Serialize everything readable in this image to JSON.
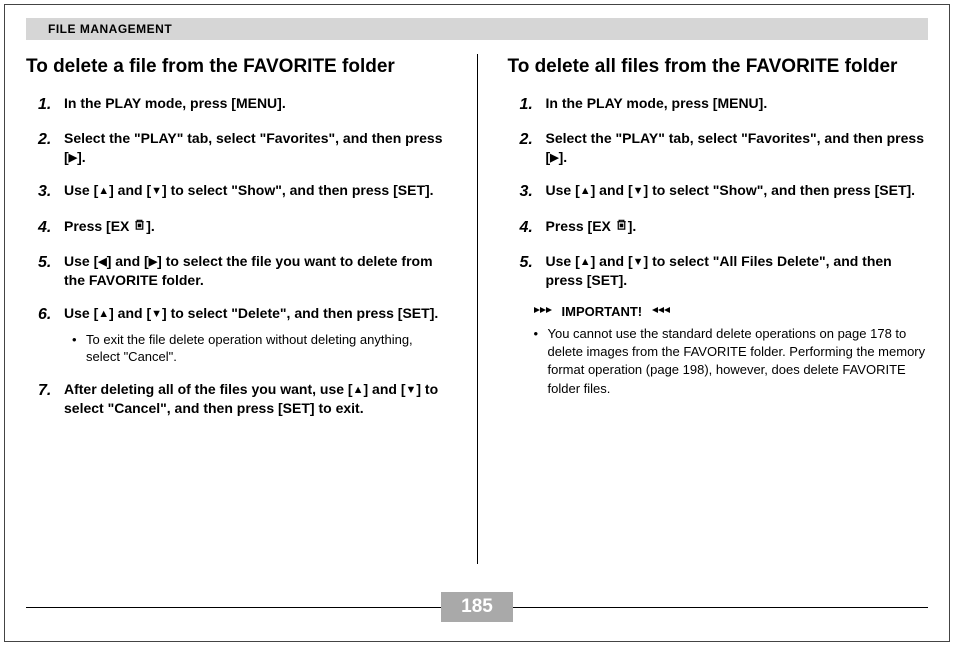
{
  "section_title": "FILE MANAGEMENT",
  "page_number": "185",
  "glyphs": {
    "triangle_up": "▲",
    "triangle_down": "▼",
    "triangle_left": "◀",
    "triangle_right": "▶"
  },
  "left": {
    "heading": "To delete a file from the FAVORITE folder",
    "steps": [
      {
        "num": "1.",
        "text": "In the PLAY mode, press [MENU]."
      },
      {
        "num": "2.",
        "text_before": "Select the \"PLAY\" tab, select \"Favorites\", and then press [",
        "arrow": "right",
        "text_after": "]."
      },
      {
        "num": "3.",
        "text_before": "Use [",
        "arrow1": "up",
        "mid": "] and [",
        "arrow2": "down",
        "text_after": "] to select \"Show\", and then press [SET]."
      },
      {
        "num": "4.",
        "text_before": "Press [EX ",
        "trash": true,
        "text_after": "]."
      },
      {
        "num": "5.",
        "text_before": "Use [",
        "arrow1": "left",
        "mid": "] and [",
        "arrow2": "right",
        "text_after": "] to select the file you want to delete from the FAVORITE folder."
      },
      {
        "num": "6.",
        "text_before": "Use [",
        "arrow1": "up",
        "mid": "] and [",
        "arrow2": "down",
        "text_after": "] to select \"Delete\", and then press [SET].",
        "sub": "To exit the file delete operation without deleting anything, select \"Cancel\"."
      },
      {
        "num": "7.",
        "text_before": "After deleting all of the files you want, use [",
        "arrow1": "up",
        "mid": "] and [",
        "arrow2": "down",
        "text_after": "] to select \"Cancel\", and then press [SET] to exit."
      }
    ]
  },
  "right": {
    "heading": "To delete all files from the FAVORITE folder",
    "steps": [
      {
        "num": "1.",
        "text": "In the PLAY mode, press [MENU]."
      },
      {
        "num": "2.",
        "text_before": "Select the \"PLAY\" tab, select \"Favorites\", and then press [",
        "arrow": "right",
        "text_after": "]."
      },
      {
        "num": "3.",
        "text_before": "Use [",
        "arrow1": "up",
        "mid": "] and [",
        "arrow2": "down",
        "text_after": "] to select \"Show\", and then press [SET]."
      },
      {
        "num": "4.",
        "text_before": "Press [EX ",
        "trash": true,
        "text_after": "]."
      },
      {
        "num": "5.",
        "text_before": "Use [",
        "arrow1": "up",
        "mid": "] and [",
        "arrow2": "down",
        "text_after": "] to select \"All Files Delete\", and then press [SET]."
      }
    ],
    "important_label": "IMPORTANT!",
    "important_note": "You cannot use the standard delete operations on page 178 to delete images from the FAVORITE folder. Performing the memory format operation (page 198), however, does delete FAVORITE folder files."
  }
}
